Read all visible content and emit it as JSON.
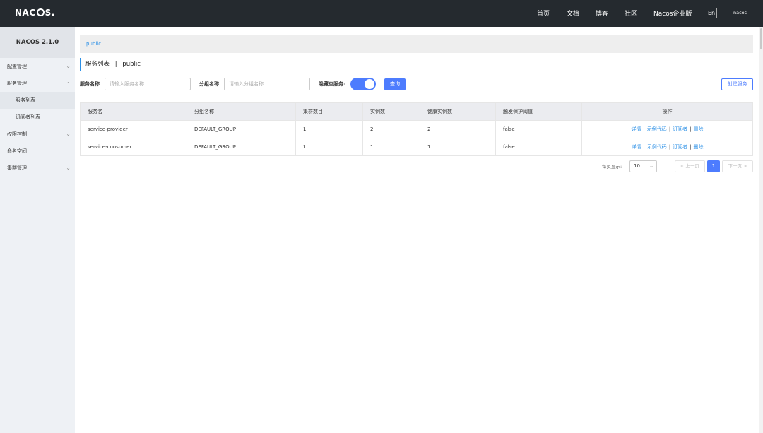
{
  "header": {
    "logo": "NACOS.",
    "nav": [
      "首页",
      "文档",
      "博客",
      "社区",
      "Nacos企业版"
    ],
    "lang": "En",
    "user": "nacos"
  },
  "sidebar": {
    "version": "NACOS 2.1.0",
    "items": [
      {
        "label": "配置管理"
      },
      {
        "label": "服务管理"
      },
      {
        "label": "服务列表"
      },
      {
        "label": "订阅者列表"
      },
      {
        "label": "权限控制"
      },
      {
        "label": "命名空间"
      },
      {
        "label": "集群管理"
      }
    ]
  },
  "breadcrumb": "public",
  "page": {
    "title": "服务列表",
    "sep": "|",
    "namespace": "public"
  },
  "filters": {
    "service_name_label": "服务名称",
    "service_name_placeholder": "请输入服务名称",
    "group_name_label": "分组名称",
    "group_name_placeholder": "请输入分组名称",
    "hide_empty_label": "隐藏空服务:",
    "hide_empty_on": true,
    "query_button": "查询",
    "create_button": "创建服务"
  },
  "table": {
    "headers": [
      "服务名",
      "分组名称",
      "集群数目",
      "实例数",
      "健康实例数",
      "触发保护阈值",
      "操作"
    ],
    "rows": [
      {
        "name": "service-provider",
        "group": "DEFAULT_GROUP",
        "clusters": "1",
        "instances": "2",
        "healthy": "2",
        "threshold": "false"
      },
      {
        "name": "service-consumer",
        "group": "DEFAULT_GROUP",
        "clusters": "1",
        "instances": "1",
        "healthy": "1",
        "threshold": "false"
      }
    ],
    "actions": [
      "详情",
      "示例代码",
      "订阅者",
      "删除"
    ],
    "action_sep": "|"
  },
  "pagination": {
    "page_size_label": "每页显示:",
    "page_size": "10",
    "prev": "< 上一页",
    "current": "1",
    "next": "下一页 >"
  },
  "colors": {
    "topbar": "#252a2f",
    "accent": "#4d7cfe",
    "link": "#2a8fe6",
    "sidebar": "#eef1f5"
  }
}
